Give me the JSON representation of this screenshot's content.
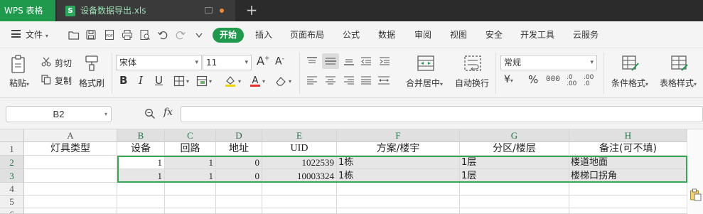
{
  "app": {
    "name": "WPS 表格",
    "doc_name": "设备数据导出.xls",
    "close": "×",
    "new_tab": "+"
  },
  "menu": {
    "file": "文件",
    "tabs": [
      "开始",
      "插入",
      "页面布局",
      "公式",
      "数据",
      "审阅",
      "视图",
      "安全",
      "开发工具",
      "云服务"
    ]
  },
  "ribbon": {
    "paste": "粘贴",
    "cut": "剪切",
    "copy": "复制",
    "format_painter": "格式刷",
    "font_name": "宋体",
    "font_size": "11",
    "merge_center": "合并居中",
    "wrap_text": "自动换行",
    "number_format": "常规",
    "conditional_format": "条件格式",
    "table_style": "表格样式"
  },
  "formula_bar": {
    "cell_ref": "B2",
    "fx": "fx",
    "content": ""
  },
  "sheet": {
    "columns": [
      "A",
      "B",
      "C",
      "D",
      "E",
      "F",
      "G",
      "H"
    ],
    "rows": [
      "1",
      "2",
      "3",
      "4",
      "5",
      "6"
    ],
    "header": [
      "灯具类型",
      "设备",
      "回路",
      "地址",
      "UID",
      "方案/楼宇",
      "分区/楼层",
      "备注(可不填)"
    ],
    "data": [
      [
        "",
        "1",
        "1",
        "0",
        "1022539",
        "1栋",
        "1层",
        "楼道地面"
      ],
      [
        "",
        "1",
        "1",
        "0",
        "10003324",
        "1栋",
        "1层",
        "楼梯口拐角"
      ]
    ]
  },
  "colors": {
    "accent": "#1f9a4d",
    "selection": "#34a853",
    "titlebar": "#2b2b2b"
  }
}
